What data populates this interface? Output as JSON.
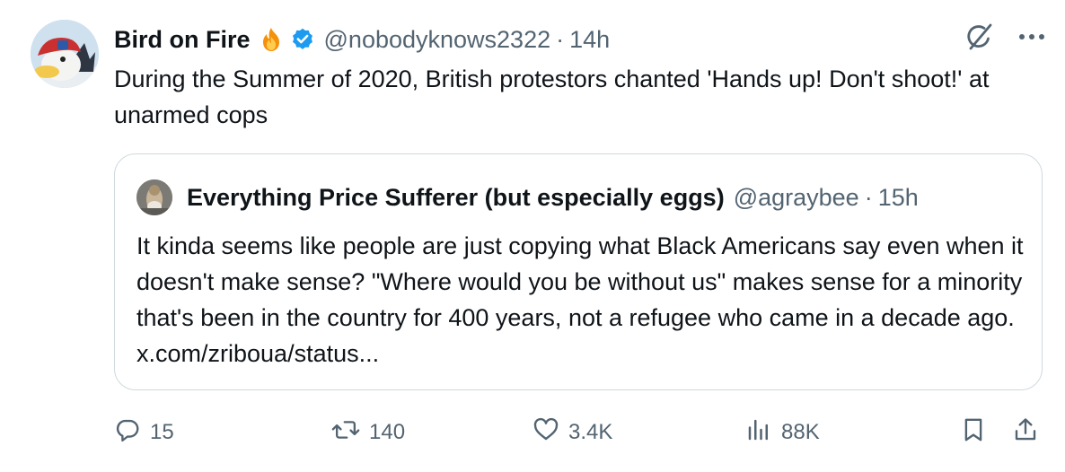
{
  "tweet": {
    "author": {
      "display_name": "Bird on Fire",
      "handle": "@nobodyknows2322",
      "time": "14h",
      "separator": "·"
    },
    "text": "During the Summer of 2020, British protestors chanted 'Hands up! Don't shoot!' at unarmed cops"
  },
  "quote": {
    "author": {
      "display_name": "Everything Price Sufferer (but especially eggs)",
      "handle": "@agraybee",
      "time": "15h",
      "separator": "·"
    },
    "text": "It kinda seems like people are just copying what Black Americans say even when it doesn't make sense? \"Where would you be without us\" makes sense for a minority that's been in the country for 400 years, not a refugee who came in a decade ago.",
    "link": "x.com/zriboua/status..."
  },
  "actions": {
    "replies": "15",
    "reposts": "140",
    "likes": "3.4K",
    "views": "88K"
  },
  "icons": {
    "grok": "grok-icon",
    "more": "more-icon",
    "reply": "reply-icon",
    "repost": "repost-icon",
    "like": "heart-icon",
    "views": "views-icon",
    "bookmark": "bookmark-icon",
    "share": "share-icon",
    "verified": "verified-badge-icon",
    "fire": "fire-emoji-icon"
  },
  "colors": {
    "text": "#0f1419",
    "secondary": "#536471",
    "border": "#cfd9de",
    "verified": "#1d9bf0"
  }
}
